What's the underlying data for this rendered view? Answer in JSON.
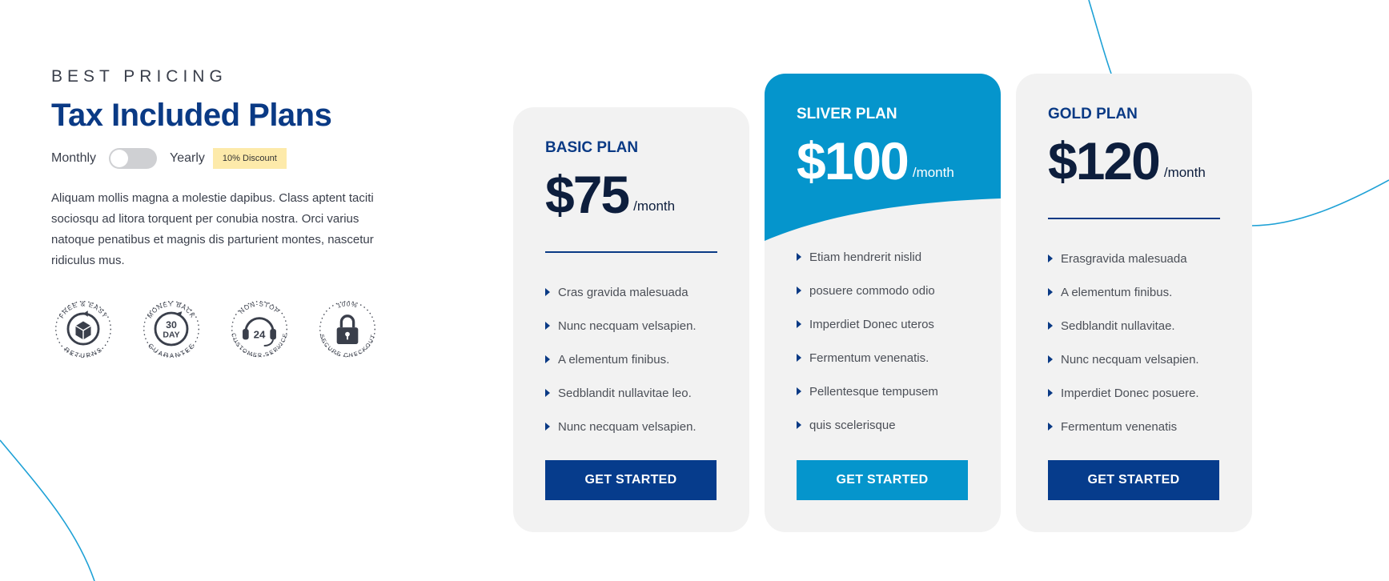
{
  "header": {
    "eyebrow": "BEST PRICING",
    "title": "Tax Included Plans"
  },
  "billing_toggle": {
    "monthly_label": "Monthly",
    "yearly_label": "Yearly",
    "discount_badge": "10% Discount",
    "state": "monthly"
  },
  "description": "Aliquam mollis magna a molestie dapibus. Class aptent taciti sociosqu ad litora torquent per conubia nostra. Orci varius natoque penatibus et magnis dis parturient montes, nascetur ridiculus mus.",
  "trust_badges": [
    {
      "icon": "box-return-icon",
      "top_text": "FREE & EASY",
      "center_text": "",
      "bottom_text": "RETURNS"
    },
    {
      "icon": "30-day-icon",
      "top_text": "MONEY BACK",
      "center_text": "30 DAY",
      "bottom_text": "GUARANTEE"
    },
    {
      "icon": "headset-24-icon",
      "top_text": "NON-STOP",
      "center_text": "24",
      "bottom_text": "CUSTOMER SERVICE"
    },
    {
      "icon": "padlock-icon",
      "top_text": "100%",
      "center_text": "",
      "bottom_text": "SECURE CHECKOUT"
    }
  ],
  "plans": [
    {
      "name": "BASIC PLAN",
      "currency": "$",
      "price": "75",
      "period": "/month",
      "features": [
        "Cras gravida malesuada",
        "Nunc necquam velsapien.",
        "A elementum finibus.",
        "Sedblandit nullavitae leo.",
        "Nunc necquam velsapien."
      ],
      "cta": "GET STARTED"
    },
    {
      "name": "SLIVER PLAN",
      "currency": "$",
      "price": "100",
      "period": "/month",
      "features": [
        "Etiam hendrerit nislid",
        "posuere commodo odio",
        "Imperdiet Donec uteros",
        "Fermentum venenatis.",
        "Pellentesque tempusem",
        "quis scelerisque"
      ],
      "cta": "GET STARTED",
      "highlight_color": "#0595cc"
    },
    {
      "name": "GOLD PLAN",
      "currency": "$",
      "price": "120",
      "period": "/month",
      "features": [
        "Erasgravida malesuada",
        "A elementum finibus.",
        "Sedblandit nullavitae.",
        "Nunc necquam velsapien.",
        "Imperdiet Donec posuere.",
        "Fermentum venenatis"
      ],
      "cta": "GET STARTED"
    }
  ],
  "colors": {
    "brand_navy": "#0a3a85",
    "button_navy": "#063c8c",
    "accent_blue": "#0595cc",
    "card_bg": "#f2f2f2",
    "discount_bg": "#fdeaaa"
  }
}
